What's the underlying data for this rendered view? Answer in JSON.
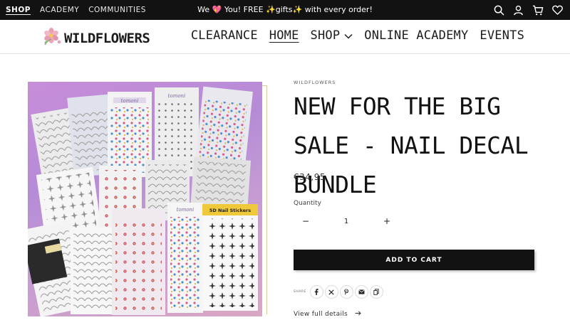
{
  "topbar": {
    "nav": [
      "SHOP",
      "ACADEMY",
      "COMMUNITIES"
    ],
    "announcement": "We 💖 You! FREE ✨gifts✨ with every order!",
    "icons": [
      "search-icon",
      "account-icon",
      "cart-icon",
      "wishlist-icon"
    ]
  },
  "header": {
    "logo_text": "WILDFLOWERS",
    "nav": {
      "clearance": "CLEARANCE",
      "home": "HOME",
      "shop": "SHOP",
      "academy": "ONLINE ACADEMY",
      "events": "EVENTS"
    }
  },
  "product": {
    "vendor": "WILDFLOWERS",
    "title": "NEW FOR THE BIG SALE - NAIL DECAL BUNDLE",
    "price": "€34,95",
    "quantity_label": "Quantity",
    "quantity_value": "1",
    "minus": "−",
    "plus": "+",
    "add_to_cart": "ADD TO CART",
    "share_label": "SHARE",
    "share_icons": [
      "facebook-icon",
      "x-icon",
      "pinterest-icon",
      "email-icon",
      "copy-link-icon"
    ],
    "view_details": "View full details",
    "image_labels": {
      "tomoni_1": "tomoni",
      "tomoni_2": "tomoni",
      "tomoni_3": "tomoni",
      "sticker_pack": "5D Nail Stickers"
    }
  },
  "colors": {
    "topbar_bg": "#121212",
    "button_bg": "#121212",
    "photo_bg": "#c49bd3"
  }
}
